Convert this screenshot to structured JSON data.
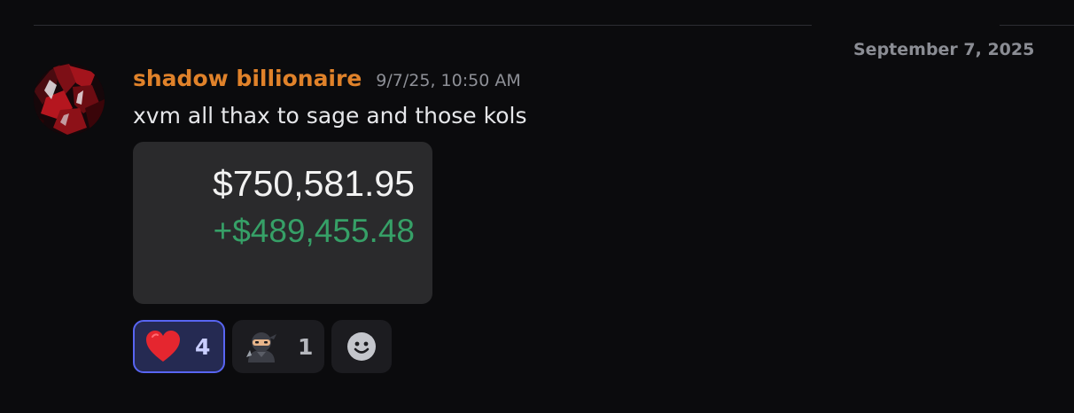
{
  "divider": {
    "date_label": "September 7, 2025"
  },
  "message": {
    "username": "shadow billionaire",
    "timestamp": "9/7/25, 10:50 AM",
    "text": "xvm all thax to sage and those kols",
    "username_color": "#e0822a"
  },
  "attachment": {
    "balance": "$750,581.95",
    "gain": "+$489,455.48",
    "gain_color": "#36a067"
  },
  "reactions": [
    {
      "emoji": "heart-icon",
      "count": "4",
      "active": true
    },
    {
      "emoji": "ninja-icon",
      "count": "1",
      "active": false
    }
  ],
  "add_reaction": {
    "icon": "smile-add-icon"
  },
  "colors": {
    "background": "#0b0b0d",
    "accent": "#5865f2"
  }
}
